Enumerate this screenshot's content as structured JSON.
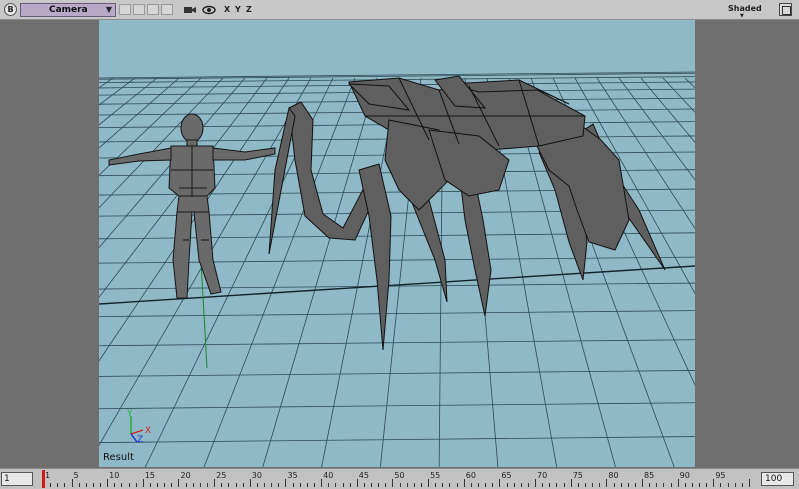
{
  "toolbar": {
    "badge": "B",
    "camera_label": "Camera",
    "dropdown_arrow": "▼",
    "axes": [
      "X",
      "Y",
      "Z"
    ],
    "shading_mode": "Shaded",
    "icons": [
      "camera-icon",
      "eye-icon",
      "maximize-icon"
    ]
  },
  "viewport": {
    "label": "Result",
    "background": "#8fb9c7",
    "gizmo": {
      "x": "X",
      "y": "Y",
      "z": "Z"
    }
  },
  "timeline": {
    "start_frame": "1",
    "end_frame": "100",
    "current_frame": 1,
    "tick_labels": [
      "1",
      "5",
      "10",
      "15",
      "20",
      "25",
      "30",
      "35",
      "40",
      "45",
      "50",
      "55",
      "60",
      "65",
      "70",
      "75",
      "80",
      "85",
      "90",
      "95"
    ]
  },
  "colors": {
    "grid": "#2e4a55",
    "mesh_fill": "#6a6a6a",
    "mesh_edge": "#1a1a1a",
    "playhead": "#d21818"
  }
}
